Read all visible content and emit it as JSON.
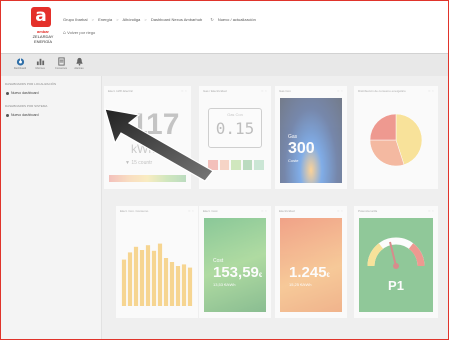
{
  "header": {
    "brand": "ambar",
    "brand_sub": "ZELARDAY ENERGÍA",
    "brand_tag": "",
    "breadcrumbs": [
      "Grupo Ibarbal",
      "Energía",
      "Alhóndiga",
      "Dashboard Nexus Ambarhub"
    ],
    "refresh_label": "Nuevo / actualización",
    "back_label": "Volver por riego"
  },
  "toolbar": {
    "items": [
      {
        "label": "Dashboard",
        "icon": "dashboard-icon"
      },
      {
        "label": "Informes",
        "icon": "bar-chart-icon"
      },
      {
        "label": "Consumos",
        "icon": "document-icon"
      },
      {
        "label": "Alarmas",
        "icon": "bell-icon"
      }
    ]
  },
  "sidebar": {
    "section1": "DASHBOARDS POR LOCALIZACIÓN",
    "item1": "Nuevo dashboard",
    "section2": "DASHBOARDS POR SISTEMA",
    "item2": "Nuevo dashboard"
  },
  "widgets": {
    "w1": {
      "title": "Elect. kWh Electric",
      "value": "117",
      "unit": "kWh",
      "note": "15 countr"
    },
    "w2": {
      "title": "Gas / Electricidad",
      "display_top": "Gas Con",
      "display_value": "0.15"
    },
    "w3": {
      "title": "Gas Con",
      "label": "Gas",
      "value": "300",
      "sub": "Coste"
    },
    "w4": {
      "title": "Distribución de consumo energético"
    },
    "w5": {
      "title": "Elect. Con. Consumo"
    },
    "w6": {
      "title": "Elect. Cost",
      "label": "Cost",
      "value": "153,59",
      "unit": "€",
      "sub": "13,53 €/kWh"
    },
    "w7": {
      "title": "Electricidad",
      "value": "1.245",
      "unit": "€",
      "sub": "15,25 €/kWh"
    },
    "w8": {
      "title": "Potencia tarifa",
      "value": "P1"
    }
  },
  "colors": {
    "brand": "#e4302a",
    "accent": "#de3b2a",
    "toolbar": "#e8e8e8"
  },
  "chart_data": [
    {
      "type": "pie",
      "values": [
        45,
        30,
        25
      ],
      "colors": [
        "#f7d04d",
        "#f0855a",
        "#e64a3a"
      ]
    },
    {
      "type": "bar",
      "values": [
        58,
        67,
        74,
        70,
        76,
        69,
        78,
        60,
        55,
        50,
        52,
        48
      ]
    }
  ]
}
